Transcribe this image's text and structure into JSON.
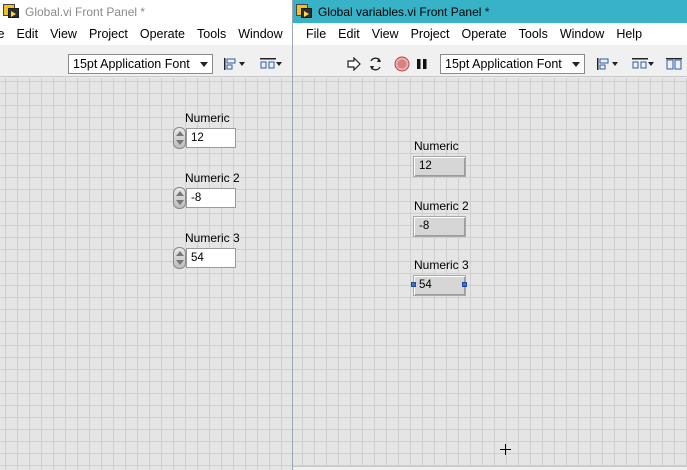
{
  "back_window": {
    "title": "Global.vi Front Panel *",
    "menu": [
      "ile",
      "Edit",
      "View",
      "Project",
      "Operate",
      "Tools",
      "Window"
    ],
    "font_selector": "15pt Application Font",
    "controls": [
      {
        "label": "Numeric",
        "value": "12"
      },
      {
        "label": "Numeric 2",
        "value": "-8"
      },
      {
        "label": "Numeric 3",
        "value": "54"
      }
    ]
  },
  "front_window": {
    "title": "Global variables.vi Front Panel *",
    "menu": [
      "File",
      "Edit",
      "View",
      "Project",
      "Operate",
      "Tools",
      "Window",
      "Help"
    ],
    "font_selector": "15pt Application Font",
    "indicators": [
      {
        "label": "Numeric",
        "value": "12"
      },
      {
        "label": "Numeric 2",
        "value": "-8"
      },
      {
        "label": "Numeric 3",
        "value": "54"
      }
    ]
  },
  "icons": {
    "run": "run-arrow-icon",
    "run_continuous": "run-continuously-icon",
    "abort": "abort-execution-icon",
    "pause": "pause-icon",
    "align": "align-objects-icon",
    "distribute": "distribute-objects-icon",
    "resize": "resize-objects-icon"
  },
  "colors": {
    "active_titlebar": "#38b2c7",
    "selection_handle": "#3a6fd8"
  }
}
